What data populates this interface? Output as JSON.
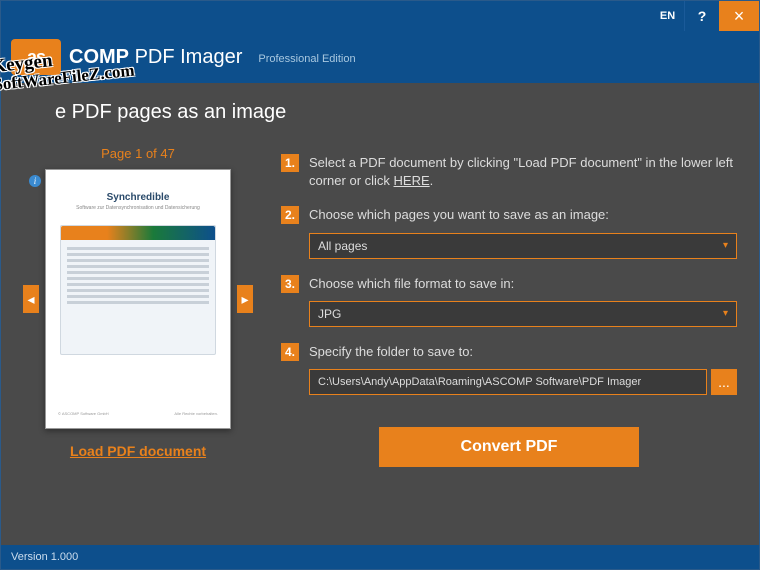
{
  "titlebar": {
    "lang": "EN",
    "help": "?",
    "close": "×"
  },
  "header": {
    "logo_badge": "as",
    "logo_text_prefix": "COMP",
    "product": "PDF Imager",
    "edition": "Professional Edition"
  },
  "watermark": {
    "line1": "Keygen",
    "line2": "SoftWareFileZ.com"
  },
  "page": {
    "title": "e PDF pages as an image"
  },
  "preview": {
    "counter": "Page 1 of 47",
    "doc_title": "Synchredible",
    "doc_subtitle": "Software zur Datensynchronisation und Datensicherung",
    "load_link": "Load PDF document",
    "nav_prev": "◂",
    "nav_next": "▸",
    "info_glyph": "i"
  },
  "steps": {
    "s1": {
      "num": "1.",
      "text_a": "Select a PDF document by clicking \"Load PDF document\" in the lower left corner or click ",
      "text_link": "HERE",
      "text_b": "."
    },
    "s2": {
      "num": "2.",
      "text": "Choose which pages you want to save as an image:",
      "value": "All pages"
    },
    "s3": {
      "num": "3.",
      "text": "Choose which file format to save in:",
      "value": "JPG"
    },
    "s4": {
      "num": "4.",
      "text": "Specify the folder to save to:",
      "path": "C:\\Users\\Andy\\AppData\\Roaming\\ASCOMP Software\\PDF Imager",
      "browse": "..."
    }
  },
  "convert": {
    "label": "Convert PDF"
  },
  "status": {
    "version": "Version 1.000"
  },
  "chev": "▾"
}
